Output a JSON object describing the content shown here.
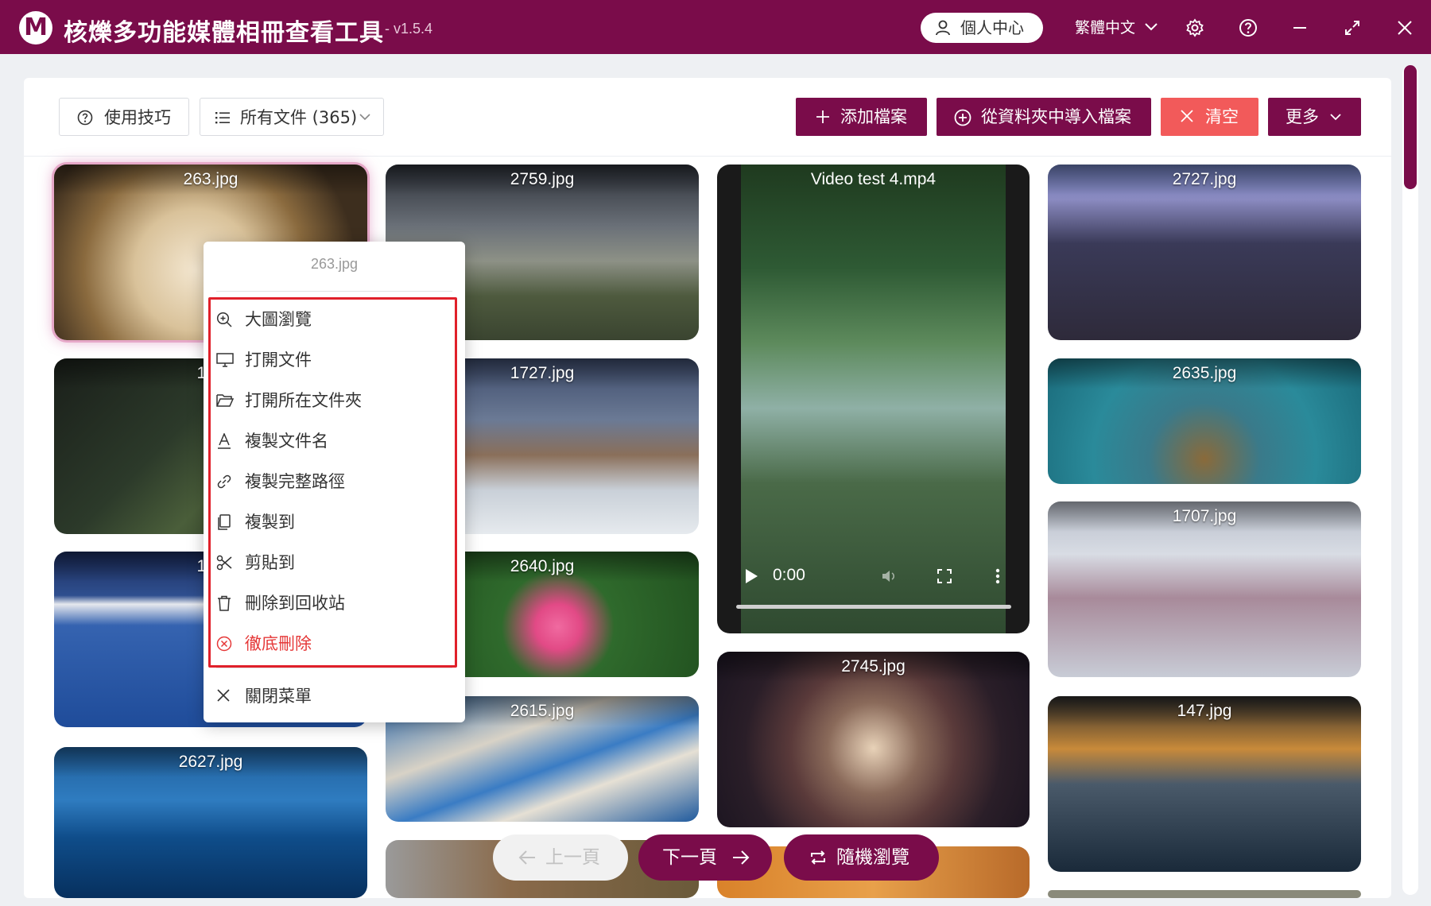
{
  "app": {
    "logo_letter": "M",
    "title": "核爍多功能媒體相冊查看工具",
    "version": "- v1.5.4",
    "user_center": "個人中心",
    "language": "繁體中文"
  },
  "toolbar": {
    "tips": "使用技巧",
    "all_files": "所有文件 (365)",
    "add_files": "添加檔案",
    "import_folder": "從資料夾中導入檔案",
    "clear": "清空",
    "more": "更多"
  },
  "thumbnails": [
    {
      "name": "263.jpg"
    },
    {
      "name": "2759.jpg"
    },
    {
      "name": "2727.jpg"
    },
    {
      "name": "174"
    },
    {
      "name": "1727.jpg"
    },
    {
      "name": "2635.jpg"
    },
    {
      "name": "178"
    },
    {
      "name": "2640.jpg"
    },
    {
      "name": "1707.jpg"
    },
    {
      "name": "2627.jpg"
    },
    {
      "name": "2615.jpg"
    },
    {
      "name": "2745.jpg"
    },
    {
      "name": "147.jpg"
    }
  ],
  "video": {
    "title": "Video test 4.mp4",
    "time": "0:00"
  },
  "context_menu": {
    "title": "263.jpg",
    "items": [
      {
        "label": "大圖瀏覽",
        "icon": "zoom-in-icon"
      },
      {
        "label": "打開文件",
        "icon": "monitor-icon"
      },
      {
        "label": "打開所在文件夾",
        "icon": "folder-open-icon"
      },
      {
        "label": "複製文件名",
        "icon": "text-a-icon"
      },
      {
        "label": "複製完整路徑",
        "icon": "link-icon"
      },
      {
        "label": "複製到",
        "icon": "copy-icon"
      },
      {
        "label": "剪貼到",
        "icon": "scissors-icon"
      },
      {
        "label": "刪除到回收站",
        "icon": "trash-icon"
      },
      {
        "label": "徹底刪除",
        "icon": "close-circle-icon"
      }
    ],
    "close": "關閉菜單"
  },
  "pagination": {
    "prev": "上一頁",
    "next": "下一頁",
    "random": "隨機瀏覽"
  },
  "colors": {
    "brand": "#7a0c4a",
    "danger": "#f25a5a",
    "highlight_border": "#e0202a"
  }
}
